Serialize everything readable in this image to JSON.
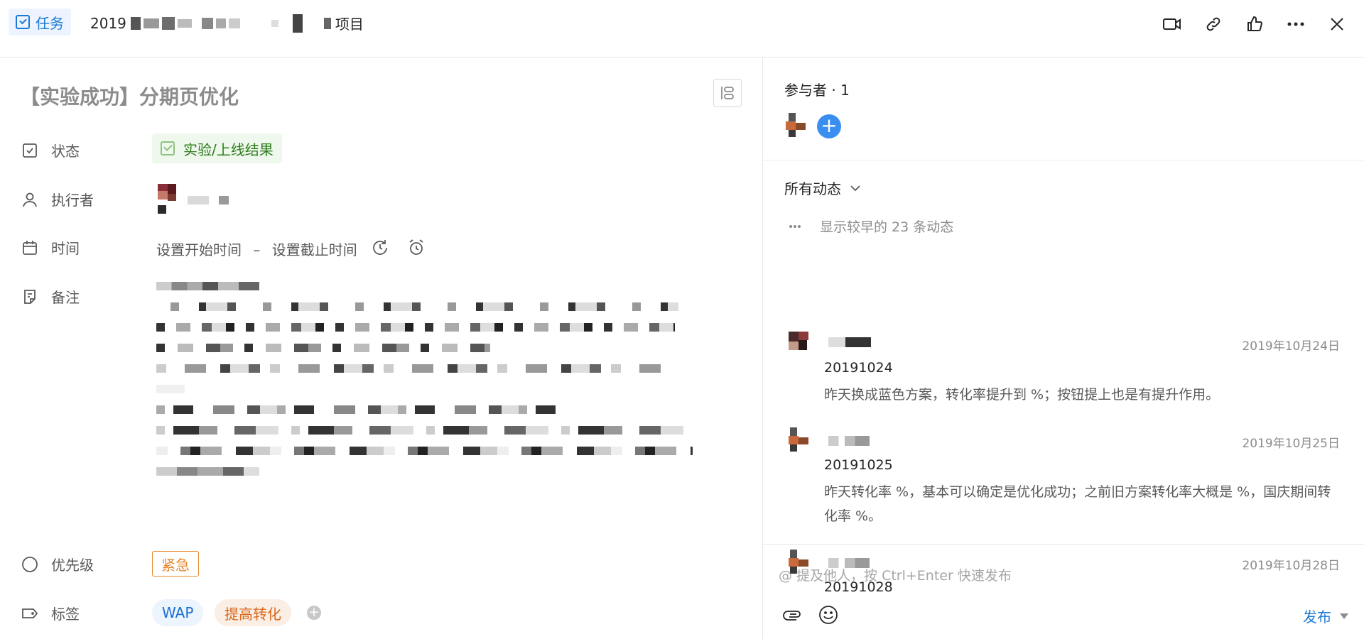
{
  "header": {
    "badge_label": "任务",
    "breadcrumb_prefix": "2019",
    "breadcrumb_suffix": "项目"
  },
  "task": {
    "title": "【实验成功】分期页优化",
    "status_label": "状态",
    "status_value": "实验/上线结果",
    "assignee_label": "执行者",
    "time_label": "时间",
    "time_start": "设置开始时间",
    "time_sep": "–",
    "time_end": "设置截止时间",
    "notes_label": "备注",
    "priority_label": "优先级",
    "priority_value": "紧急",
    "tags_label": "标签",
    "tags": [
      "WAP",
      "提高转化"
    ]
  },
  "participants": {
    "title": "参与者 · 1"
  },
  "activity": {
    "filter_label": "所有动态",
    "older_text": "显示较早的 23 条动态",
    "entries": [
      {
        "date": "2019年10月24日",
        "code": "20191024",
        "body": "昨天换成蓝色方案，转化率提升到 %；按钮提上也是有提升作用。"
      },
      {
        "date": "2019年10月25日",
        "code": "20191025",
        "body": "昨天转化率 %，基本可以确定是优化成功；之前旧方案转化率大概是 %，国庆期间转化率 %。"
      },
      {
        "date": "2019年10月28日",
        "code": "20191028",
        "body": ""
      }
    ]
  },
  "composer": {
    "placeholder": "@ 提及他人，按 Ctrl+Enter 快速发布",
    "publish_label": "发布"
  },
  "colors": {
    "accent": "#1b7ad6",
    "status_green": "#2f7d1e",
    "priority_orange": "#e6892e"
  }
}
